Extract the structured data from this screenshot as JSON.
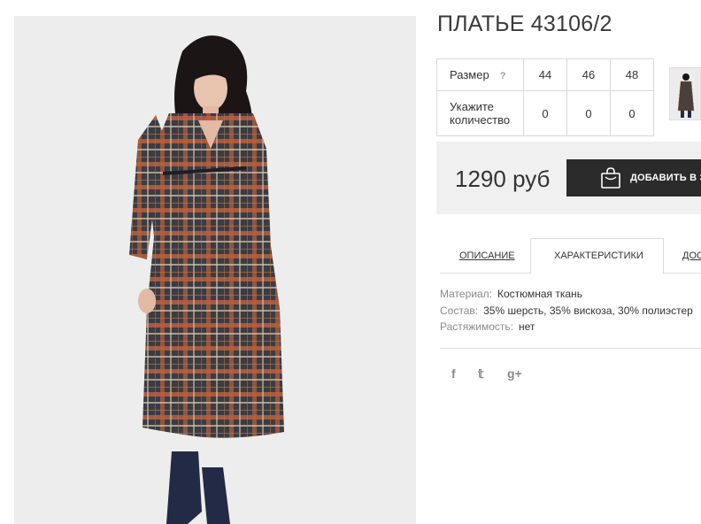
{
  "product": {
    "title": "ПЛАТЬЕ 43106/2"
  },
  "size_table": {
    "size_label": "Размер",
    "help": "?",
    "sizes": [
      "44",
      "46",
      "48"
    ],
    "qty_label_line1": "Укажите",
    "qty_label_line2": "количество",
    "quantities": [
      "0",
      "0",
      "0"
    ]
  },
  "purchase": {
    "price": "1290 руб",
    "add_button_label": "ДОБАВИТЬ В З"
  },
  "tabs": {
    "description": "ОПИСАНИЕ",
    "characteristics": "ХАРАКТЕРИСТИКИ",
    "delivery": "ДОС"
  },
  "specs": [
    {
      "key": "Материал:",
      "value": "Костюмная ткань"
    },
    {
      "key": "Состав:",
      "value": "35% шерсть, 35% вискоза, 30% полиэстер"
    },
    {
      "key": "Растяжимость:",
      "value": "нет"
    }
  ],
  "social": {
    "facebook": "f",
    "twitter": "𝕥",
    "googleplus": "g+"
  },
  "colors": {
    "button_bg": "#2b2b2b",
    "buy_box_bg": "#f0f0f0",
    "photo_bg": "#ededed"
  }
}
